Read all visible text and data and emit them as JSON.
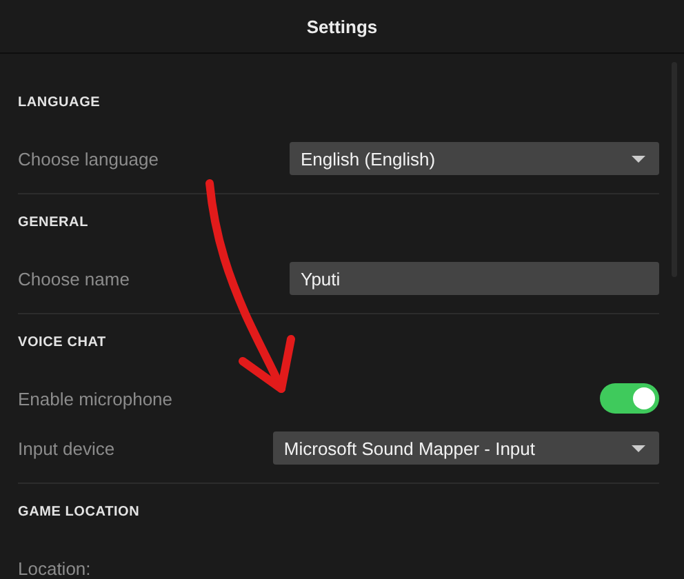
{
  "window": {
    "title": "Settings"
  },
  "sections": [
    {
      "title": "LANGUAGE",
      "rows": [
        {
          "kind": "select",
          "label": "Choose language",
          "value": "English (English)"
        }
      ]
    },
    {
      "title": "GENERAL",
      "rows": [
        {
          "kind": "text",
          "label": "Choose name",
          "value": "Yputi"
        }
      ]
    },
    {
      "title": "VOICE CHAT",
      "rows": [
        {
          "kind": "toggle",
          "label": "Enable microphone",
          "on": true
        },
        {
          "kind": "select",
          "label": "Input device",
          "value": "Microsoft Sound Mapper - Input"
        }
      ]
    },
    {
      "title": "GAME LOCATION",
      "rows": [
        {
          "kind": "label",
          "label": "Location:"
        }
      ]
    }
  ]
}
